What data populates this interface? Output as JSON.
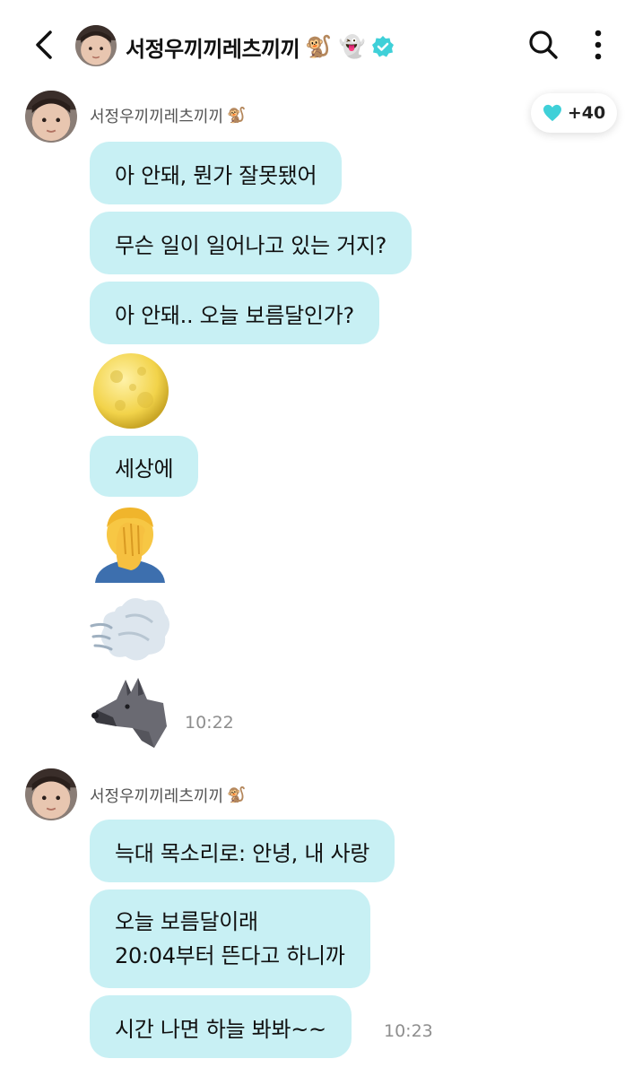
{
  "header": {
    "title": "서정우끼끼레츠끼끼",
    "title_emoji": "🐒 👻",
    "back_icon": "chevron-left-icon",
    "search_icon": "search-icon",
    "more_icon": "more-vertical-icon",
    "verified_icon": "verified-badge-icon"
  },
  "like": {
    "icon": "heart-icon",
    "count": "+40",
    "color": "#3fd0d8"
  },
  "colors": {
    "bubble": "#c8f0f4",
    "accent": "#3fd0d8",
    "time": "#8e8e8e"
  },
  "groups": [
    {
      "sender": "서정우끼끼레츠끼끼",
      "sender_emoji": "🐒",
      "messages": [
        {
          "text": "아 안돼, 뭔가 잘못됐어"
        },
        {
          "text": "무슨 일이 일어나고 있는 거지?"
        },
        {
          "text": "아 안돼.. 오늘 보름달인가?"
        },
        {
          "emoji": "full-moon-icon"
        },
        {
          "text": "세상에"
        },
        {
          "emoji": "facepalm-icon"
        },
        {
          "emoji": "wind-icon"
        },
        {
          "emoji": "wolf-icon"
        }
      ],
      "time": "10:22"
    },
    {
      "sender": "서정우끼끼레츠끼끼",
      "sender_emoji": "🐒",
      "messages": [
        {
          "text": "늑대 목소리로: 안녕, 내 사랑"
        },
        {
          "lines": [
            "오늘 보름달이래",
            "20:04부터 뜬다고 하니까"
          ]
        },
        {
          "text": "시간 나면 하늘 봐봐~~"
        }
      ],
      "time": "10:23"
    }
  ]
}
